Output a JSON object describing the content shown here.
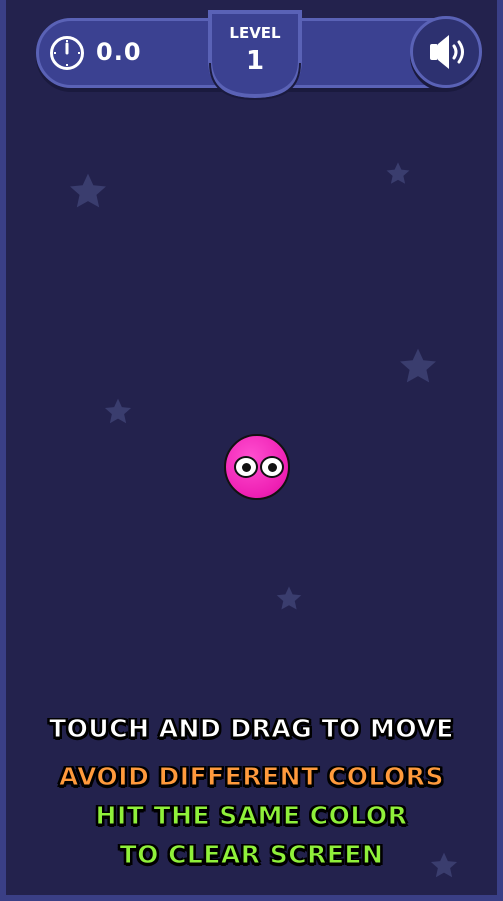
{
  "hud": {
    "timer_icon": "stopwatch-icon",
    "timer_value": "0.0",
    "level_label": "LEVEL",
    "level_number": "1",
    "sound_icon": "speaker-icon"
  },
  "player": {
    "color": "#ee1fb3"
  },
  "instructions": {
    "line1": "TOUCH AND DRAG TO MOVE",
    "line2": "AVOID DIFFERENT COLORS",
    "line3": "HIT THE SAME COLOR",
    "line4": "TO CLEAR SCREEN"
  },
  "colors": {
    "background": "#23224d",
    "hud": "#3b4191",
    "instruction_white": "#ffffff",
    "instruction_orange": "#ff9a3c",
    "instruction_green": "#8ff03a"
  }
}
